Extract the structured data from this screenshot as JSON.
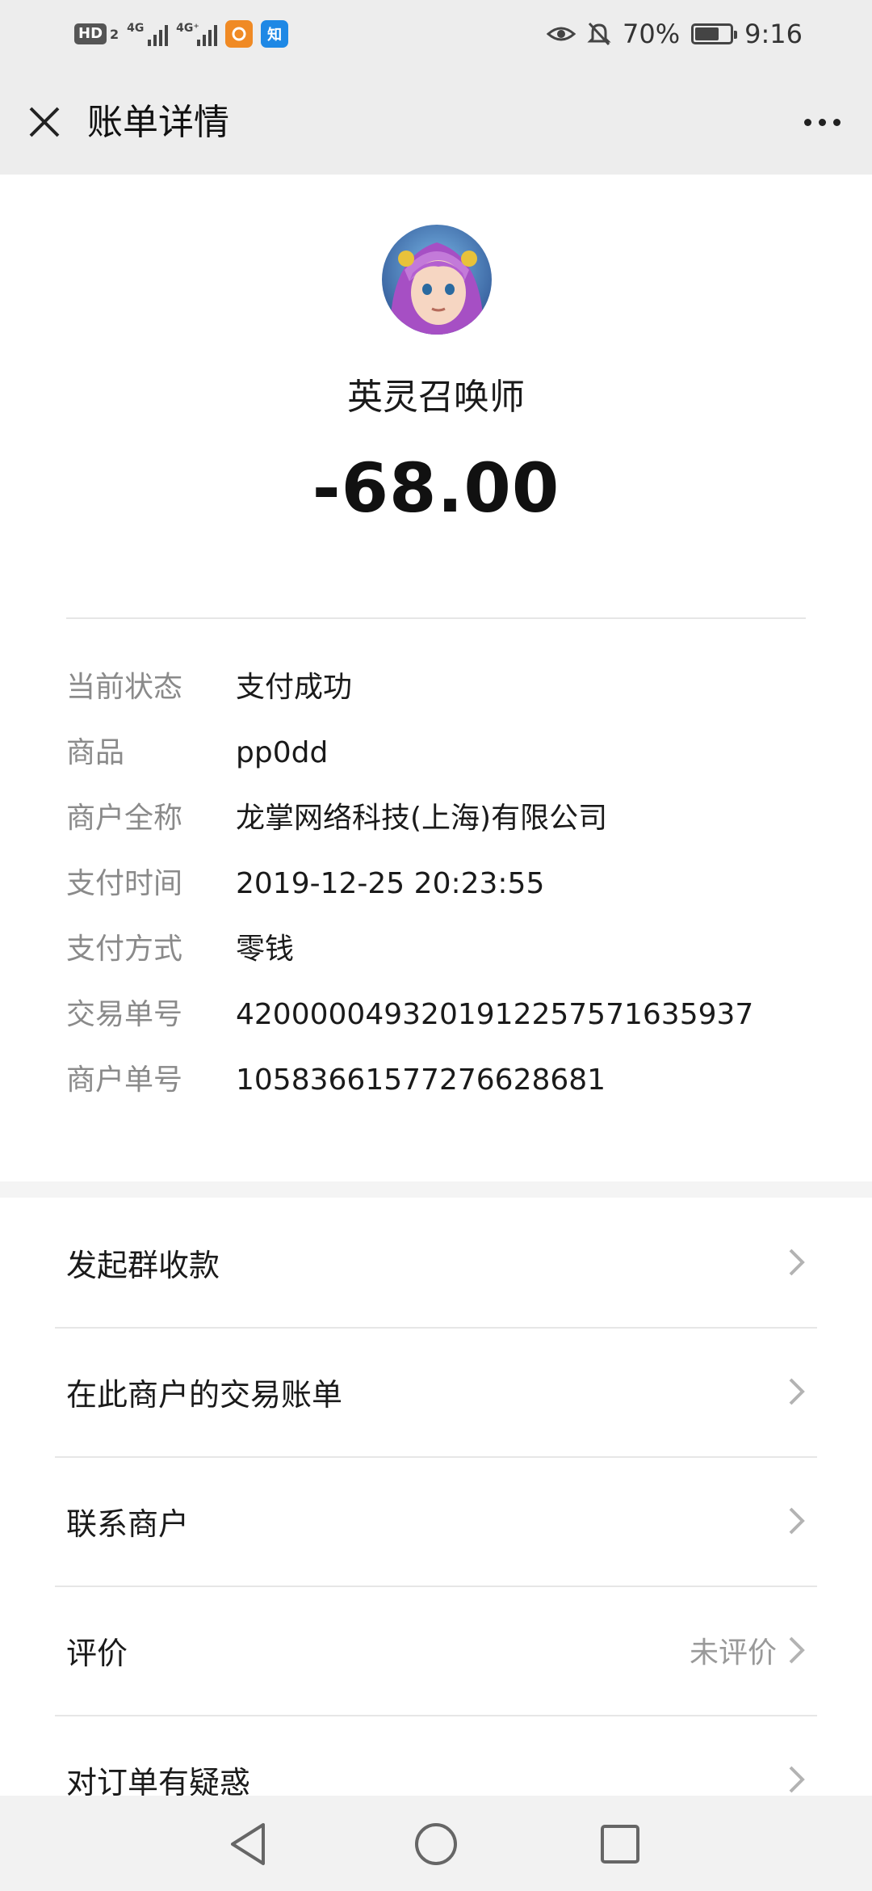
{
  "status_bar": {
    "hd_label": "HD",
    "hd_sub": "2",
    "signal1_label": "4G",
    "signal2_label": "4G⁺",
    "app1_icon": "uc-browser-icon",
    "app2_label": "知",
    "battery_percent": "70%",
    "battery_level": 0.7,
    "time": "9:16"
  },
  "nav": {
    "title": "账单详情",
    "close_icon": "close-icon",
    "more_icon": "more-icon"
  },
  "header": {
    "merchant_name": "英灵召唤师",
    "amount": "-68.00"
  },
  "details": [
    {
      "label": "当前状态",
      "value": "支付成功"
    },
    {
      "label": "商品",
      "value": "pp0dd"
    },
    {
      "label": "商户全称",
      "value": "龙掌网络科技(上海)有限公司"
    },
    {
      "label": "支付时间",
      "value": "2019-12-25 20:23:55"
    },
    {
      "label": "支付方式",
      "value": "零钱"
    },
    {
      "label": "交易单号",
      "value": "4200000493201912257571635937"
    },
    {
      "label": "商户单号",
      "value": "10583661577276628681"
    }
  ],
  "actions": [
    {
      "label": "发起群收款",
      "extra": ""
    },
    {
      "label": "在此商户的交易账单",
      "extra": ""
    },
    {
      "label": "联系商户",
      "extra": ""
    },
    {
      "label": "评价",
      "extra": "未评价"
    },
    {
      "label": "对订单有疑惑",
      "extra": ""
    }
  ],
  "colors": {
    "status_bg": "#ededed",
    "label_gray": "#8a8a8a",
    "divider": "#e6e6e6"
  }
}
